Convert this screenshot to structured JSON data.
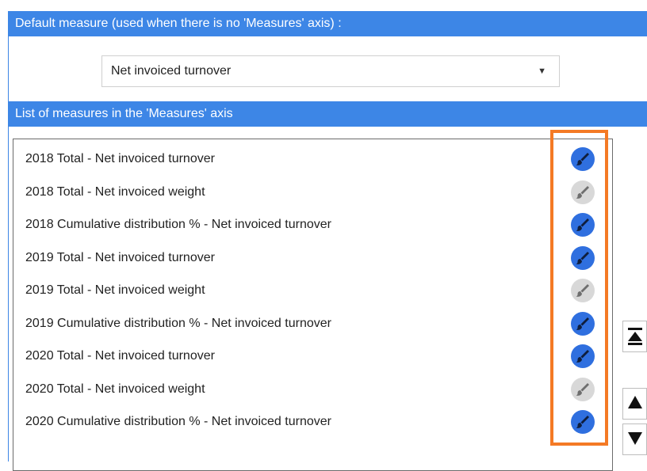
{
  "default_measure": {
    "header": "Default measure (used when there is no 'Measures' axis) :",
    "selected": "Net invoiced turnover",
    "arrow_icon": "chevron-down-icon"
  },
  "measures_axis": {
    "header": "List of measures in the 'Measures' axis",
    "items": [
      {
        "label": "2018 Total - Net invoiced turnover",
        "active": true
      },
      {
        "label": "2018 Total - Net invoiced weight",
        "active": false
      },
      {
        "label": "2018 Cumulative distribution % - Net invoiced turnover",
        "active": true
      },
      {
        "label": "2019 Total - Net invoiced turnover",
        "active": true
      },
      {
        "label": "2019 Total - Net invoiced weight",
        "active": false
      },
      {
        "label": "2019 Cumulative distribution % - Net invoiced turnover",
        "active": true
      },
      {
        "label": "2020 Total - Net invoiced turnover",
        "active": true
      },
      {
        "label": "2020 Total - Net invoiced weight",
        "active": false
      },
      {
        "label": "2020 Cumulative distribution % - Net invoiced turnover",
        "active": true
      }
    ]
  },
  "side_buttons": [
    "move-to-top-icon",
    "move-up-icon",
    "move-down-icon"
  ],
  "colors": {
    "header_blue": "#3d86e6",
    "toggle_active": "#2f6fdf",
    "toggle_inactive": "#d8d8d8",
    "highlight_orange": "#f47a25"
  }
}
